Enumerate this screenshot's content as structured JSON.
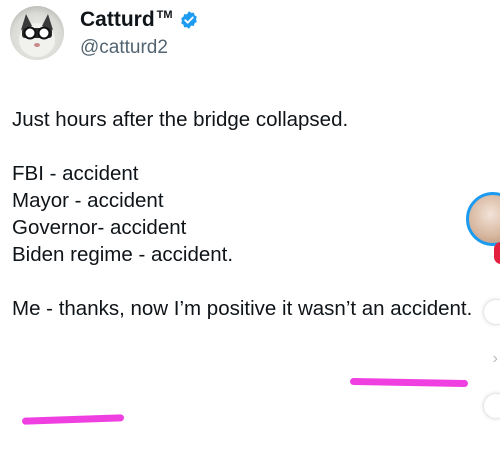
{
  "tweet": {
    "author_name": "Catturd",
    "trademark": "TM",
    "handle": "@catturd2",
    "lines": [
      "Just hours after the bridge collapsed.",
      "FBI - accident",
      "Mayor - accident",
      "Governor- accident",
      "Biden regime - accident.",
      "Me - thanks, now I’m positive it wasn’t an accident."
    ]
  },
  "colors": {
    "verified": "#1d9bf0",
    "highlight": "#f03fe0",
    "handle": "#536471"
  },
  "icons": {
    "verified": "verified-badge-icon",
    "avatar": "cat-with-glasses-avatar"
  }
}
